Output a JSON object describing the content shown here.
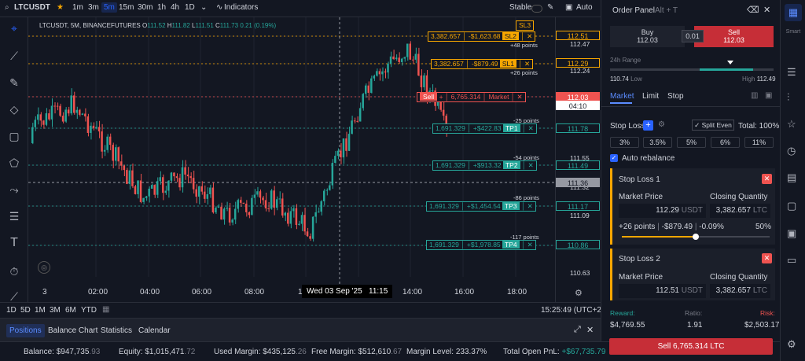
{
  "toolbar": {
    "symbol": "LTCUSDT",
    "intervals": [
      "1m",
      "3m",
      "5m",
      "15m",
      "30m",
      "1h",
      "4h",
      "1D"
    ],
    "active_interval": "5m",
    "indicators": "Indicators",
    "stable": "Stable",
    "auto": "Auto"
  },
  "legend": {
    "title": "LTCUSDT, 5M, BINANCEFUTURES",
    "o": "O",
    "o_val": "111.52",
    "h": "H",
    "h_val": "111.82",
    "l": "L",
    "l_val": "111.51",
    "c": "C",
    "c_val": "111.73",
    "chg": "0.21 (0.19%)"
  },
  "orders": {
    "sl3": "SL3",
    "sl2": {
      "qty": "3,382.657",
      "pnl": "-$1,623.68",
      "tag": "SL2",
      "points": "+48 points",
      "price": "112.51"
    },
    "sl1": {
      "qty": "3,382.657",
      "pnl": "-$879.49",
      "tag": "SL1",
      "points": "+26 points",
      "price": "112.29"
    },
    "sell": {
      "tag": "Sell",
      "plus": "+",
      "qty": "6,765.314",
      "type": "Market",
      "price": "112.03",
      "timer": "04:10"
    },
    "tp1": {
      "qty": "1,691.329",
      "pnl": "+$422.83",
      "tag": "TP1",
      "points": "-25 points",
      "price": "111.78"
    },
    "tp2": {
      "qty": "1,691.329",
      "pnl": "+$913.32",
      "tag": "TP2",
      "points": "-54 points",
      "price": "111.49"
    },
    "tp3": {
      "qty": "1,691.329",
      "pnl": "+$1,454.54",
      "tag": "TP3",
      "points": "-86 points",
      "price": "111.17"
    },
    "tp4": {
      "qty": "1,691.329",
      "pnl": "+$1,978.85",
      "tag": "TP4",
      "points": "-117 points",
      "price": "110.86"
    },
    "x": "✕"
  },
  "axis": {
    "labels": [
      "112.47",
      "112.24",
      "111.55",
      "111.32",
      "111.09",
      "110.63"
    ],
    "crosshair": "111.36"
  },
  "time_axis": {
    "labels": [
      "3",
      "02:00",
      "04:00",
      "06:00",
      "08:00",
      "1",
      "14:00",
      "16:00",
      "18:00"
    ],
    "crosshair": "Wed 03 Sep '25",
    "crosshair_time": "11:15"
  },
  "ranges": [
    "1D",
    "5D",
    "1M",
    "3M",
    "6M",
    "YTD"
  ],
  "clock": "15:25:49 (UTC+2)",
  "tabs": [
    "Positions",
    "Balance Chart",
    "Statistics",
    "Calendar"
  ],
  "status": {
    "balance_label": "Balance:",
    "balance": "$947,735",
    "balance_dec": ".93",
    "equity_label": "Equity:",
    "equity": "$1,015,471",
    "equity_dec": ".72",
    "used_label": "Used Margin:",
    "used": "$435,125",
    "used_dec": ".26",
    "free_label": "Free Margin:",
    "free": "$512,610",
    "free_dec": ".67",
    "level_label": "Margin Level:",
    "level": "233.37%",
    "pnl_label": "Total Open PnL:",
    "pnl": "+$67,735.79"
  },
  "panel": {
    "title": "Order Panel",
    "shortcut": "Alt + T",
    "buy_label": "Buy",
    "buy_price": "112.03",
    "spread": "0.01",
    "sell_label": "Sell",
    "sell_price": "112.03",
    "range_label": "24h Range",
    "low": "110.74",
    "low_label": "Low",
    "high_label": "High",
    "high": "112.49",
    "order_tabs": [
      "Market",
      "Limit",
      "Stop"
    ],
    "sl_label": "Stop Loss",
    "split": "Split Even",
    "total": "Total: 100%",
    "pct": [
      "3%",
      "3.5%",
      "5%",
      "6%",
      "11%"
    ],
    "auto": "Auto rebalance",
    "sl1": {
      "title": "Stop Loss 1",
      "mp_label": "Market Price",
      "cq_label": "Closing Quantity",
      "price": "112.29",
      "unit": "USDT",
      "qty": "3,382.657",
      "qunit": "LTC",
      "points": "+26 points",
      "pnl": "-$879.49",
      "pct": "-0.09%",
      "slider": "50%"
    },
    "sl2": {
      "title": "Stop Loss 2",
      "mp_label": "Market Price",
      "cq_label": "Closing Quantity",
      "price": "112.51",
      "unit": "USDT",
      "qty": "3,382.657",
      "qunit": "LTC"
    },
    "reward_label": "Reward:",
    "ratio_label": "Ratio:",
    "risk_label": "Risk:",
    "reward": "$4,769.55",
    "ratio": "1.91",
    "risk": "$2,503.17",
    "submit": "Sell 6,765.314 LTC"
  },
  "rail": {
    "smart": "Smart"
  },
  "colors": {
    "bg": "#131722",
    "up": "#26a69a",
    "down": "#ef5350",
    "sl": "#f7a600",
    "accent": "#2962ff"
  }
}
